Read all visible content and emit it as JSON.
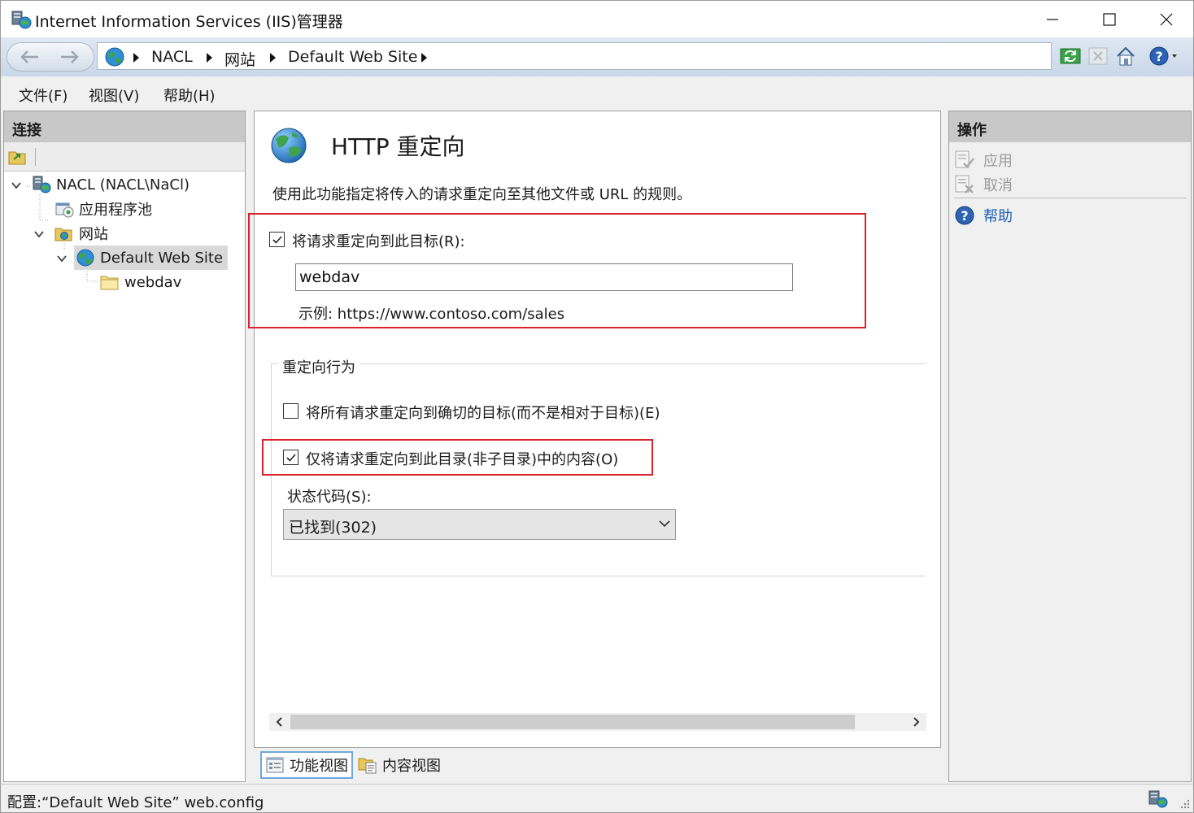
{
  "window": {
    "title": "Internet Information Services (IIS)管理器"
  },
  "breadcrumb": {
    "items": [
      "NACL",
      "网站",
      "Default Web Site"
    ]
  },
  "menu": {
    "file": "文件(F)",
    "view": "视图(V)",
    "help": "帮助(H)"
  },
  "connections": {
    "header": "连接",
    "tree": {
      "server": "NACL (NACL\\NaCl)",
      "app_pools": "应用程序池",
      "sites": "网站",
      "default_site": "Default Web Site",
      "webdav": "webdav"
    }
  },
  "feature": {
    "title": "HTTP 重定向",
    "description": "使用此功能指定将传入的请求重定向至其他文件或 URL 的规则。",
    "redirect_checkbox": {
      "label": "将请求重定向到此目标(R):",
      "checked": true
    },
    "target_value": "webdav",
    "example": "示例: https://www.contoso.com/sales",
    "behavior_group": "重定向行为",
    "exact_checkbox": {
      "label": "将所有请求重定向到确切的目标(而不是相对于目标)(E)",
      "checked": false
    },
    "only_dir_checkbox": {
      "label": "仅将请求重定向到此目录(非子目录)中的内容(O)",
      "checked": true
    },
    "status_label": "状态代码(S):",
    "status_value": "已找到(302)"
  },
  "view_tabs": {
    "features": "功能视图",
    "content": "内容视图"
  },
  "actions": {
    "header": "操作",
    "apply": "应用",
    "cancel": "取消",
    "help": "帮助"
  },
  "statusbar": {
    "text": "配置:“Default Web Site” web.config"
  },
  "colors": {
    "highlight_box": "#d9232d",
    "link_blue": "#1a5fb4",
    "disabled_text": "#9a9a9a"
  }
}
